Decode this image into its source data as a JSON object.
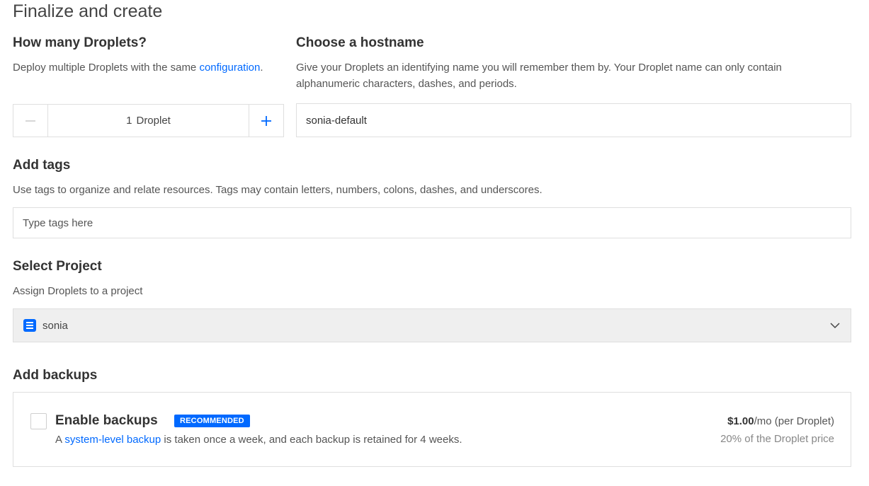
{
  "page": {
    "title": "Finalize and create"
  },
  "droplets": {
    "heading": "How many Droplets?",
    "description": "Deploy multiple Droplets with the same ",
    "description_link": "configuration",
    "description_end": ".",
    "count": "1",
    "unit": "Droplet",
    "minus_icon": "minus-icon",
    "plus_icon": "plus-icon"
  },
  "hostname": {
    "heading": "Choose a hostname",
    "description_line1": "Give your Droplets an identifying name you will remember them by. Your Droplet name can only contain",
    "description_line2": "alphanumeric characters, dashes, and periods.",
    "value": "sonia-default"
  },
  "tags": {
    "heading": "Add tags",
    "description": "Use tags to organize and relate resources. Tags may contain letters, numbers, colons, dashes, and underscores.",
    "placeholder": "Type tags here"
  },
  "project": {
    "heading": "Select Project",
    "description": "Assign Droplets to a project",
    "selected": "sonia",
    "icon": "project-icon"
  },
  "backups": {
    "heading": "Add backups",
    "title": "Enable backups",
    "badge": "RECOMMENDED",
    "desc_prefix": "A ",
    "desc_link": "system-level backup",
    "desc_suffix": " is taken once a week, and each backup is retained for 4 weeks.",
    "price_amount": "$1.00",
    "price_unit": "/mo (per Droplet)",
    "price_note": "20% of the Droplet price",
    "checked": false
  },
  "colors": {
    "accent": "#0069ff",
    "border": "#dfdfdf",
    "select_bg": "#efefef"
  }
}
